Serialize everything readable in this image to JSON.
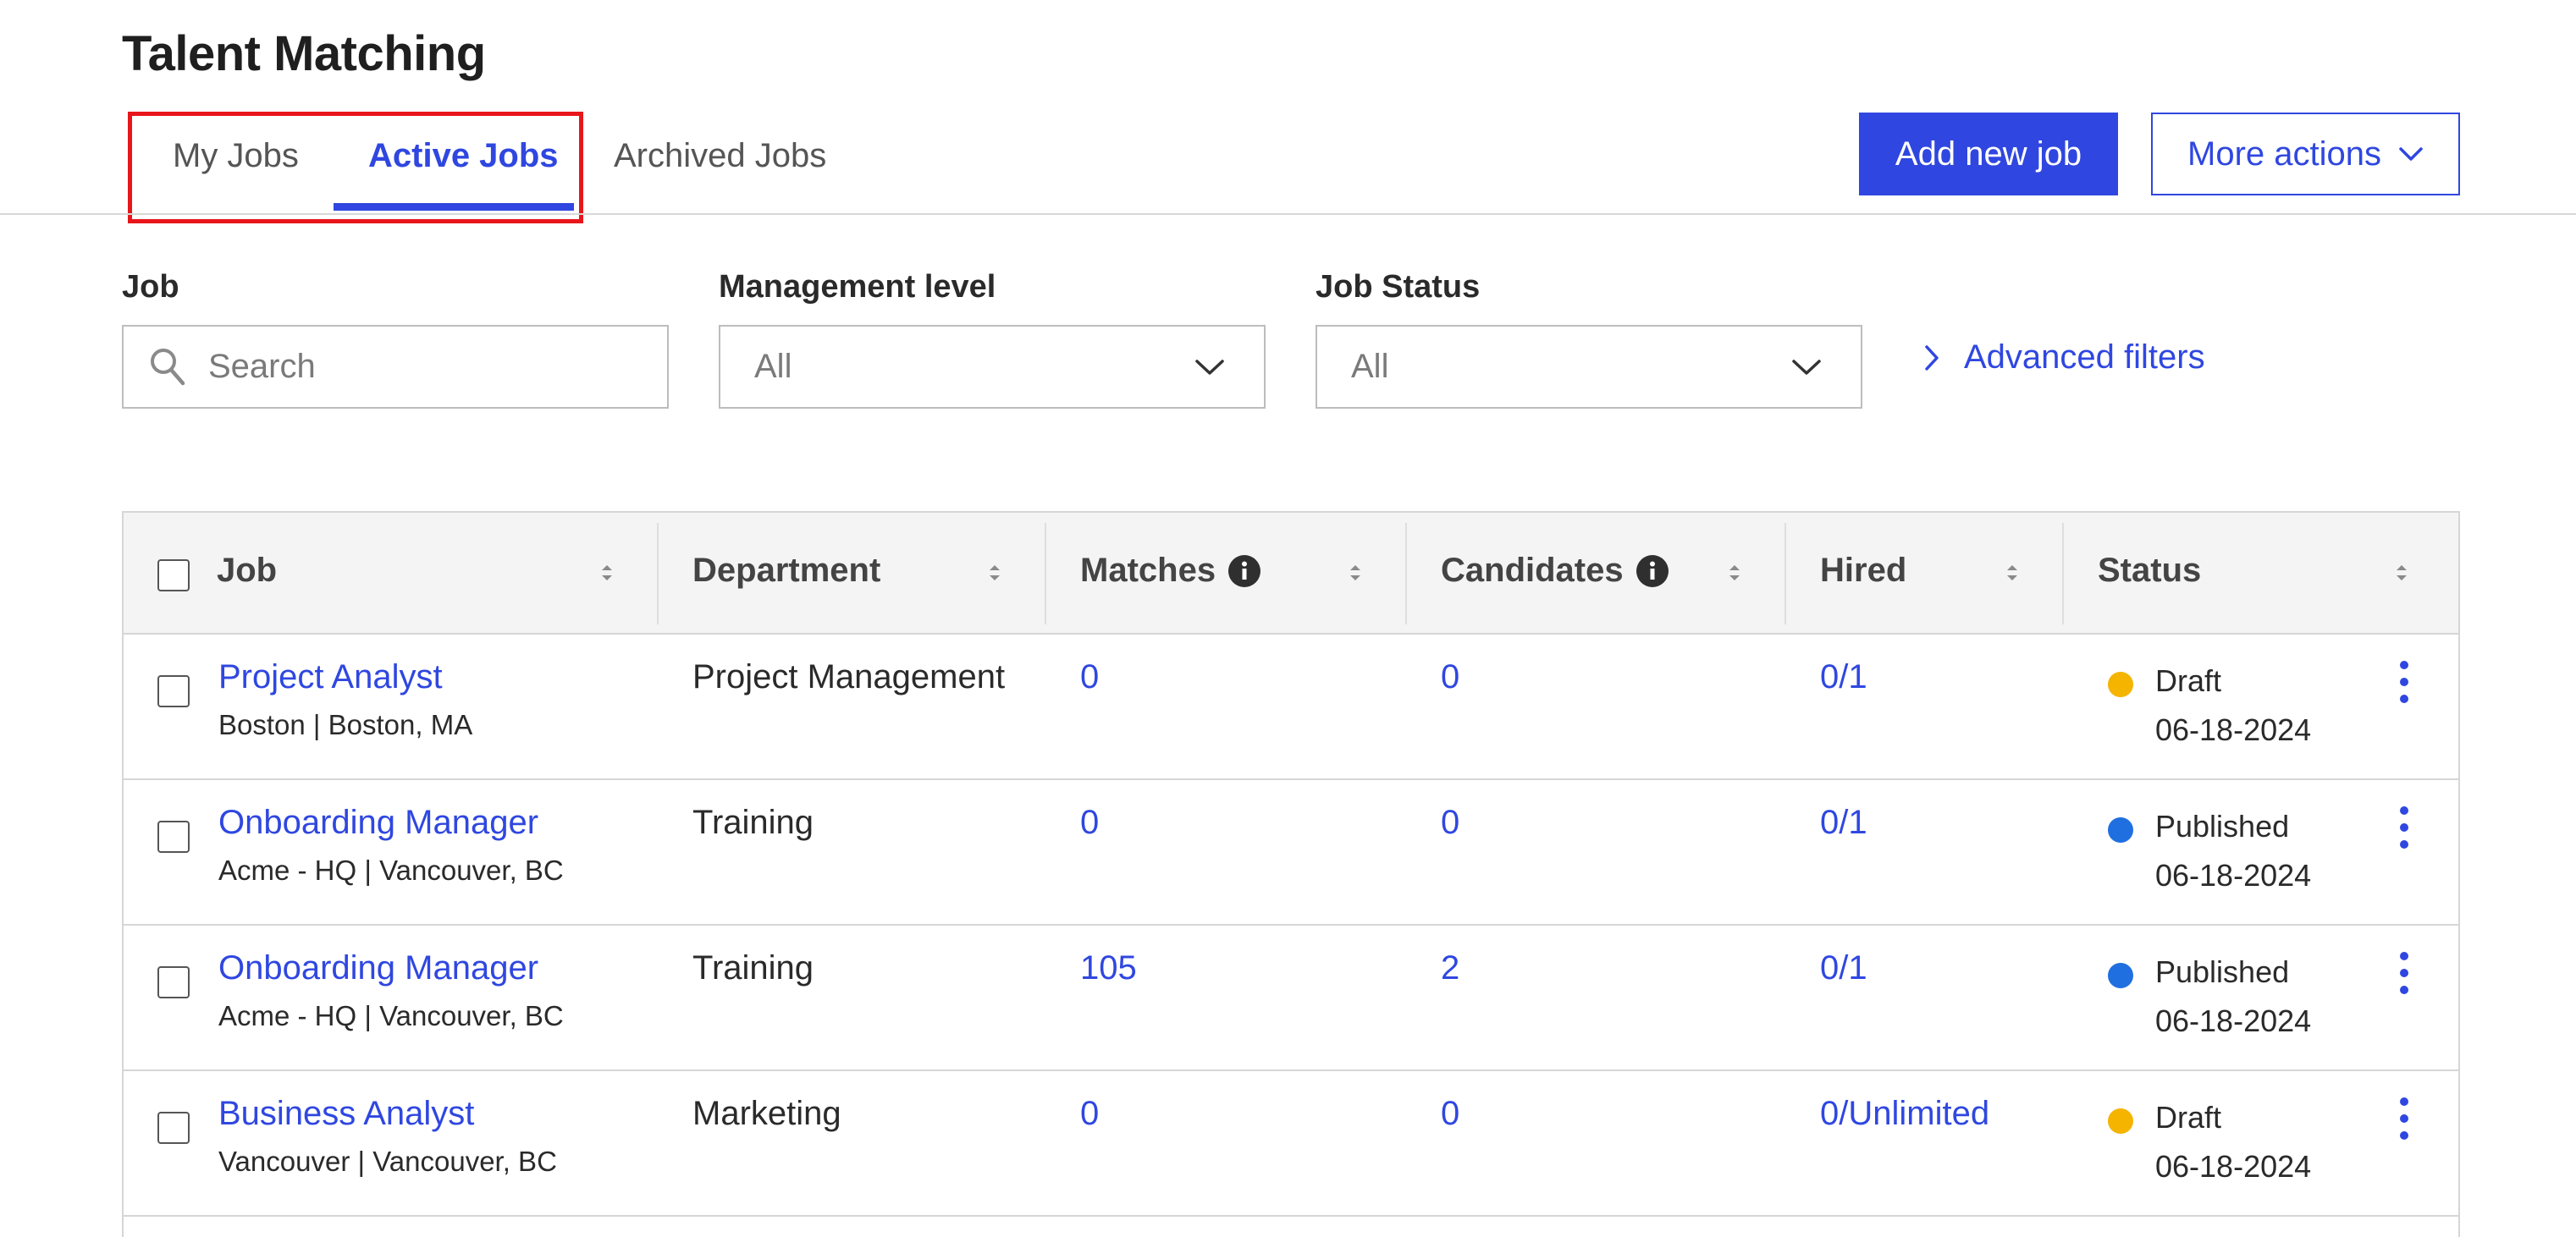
{
  "header": {
    "title": "Talent Matching",
    "tabs": [
      {
        "label": "My Jobs",
        "active": false
      },
      {
        "label": "Active Jobs",
        "active": true
      },
      {
        "label": "Archived Jobs",
        "active": false
      }
    ],
    "add_button": "Add new job",
    "more_actions": "More actions"
  },
  "filters": {
    "job_label": "Job",
    "job_placeholder": "Search",
    "management_label": "Management level",
    "management_value": "All",
    "status_label": "Job Status",
    "status_value": "All",
    "advanced": "Advanced filters"
  },
  "table": {
    "columns": [
      "Job",
      "Department",
      "Matches",
      "Candidates",
      "Hired",
      "Status"
    ],
    "rows": [
      {
        "title": "Project Analyst",
        "location": "Boston  |  Boston, MA",
        "department": "Project Management",
        "matches": "0",
        "candidates": "0",
        "hired": "0/1",
        "status": "Draft",
        "date": "06-18-2024"
      },
      {
        "title": "Onboarding Manager",
        "location": "Acme - HQ  |  Vancouver, BC",
        "department": "Training",
        "matches": "0",
        "candidates": "0",
        "hired": "0/1",
        "status": "Published",
        "date": "06-18-2024"
      },
      {
        "title": "Onboarding Manager",
        "location": "Acme - HQ  |  Vancouver, BC",
        "department": "Training",
        "matches": "105",
        "candidates": "2",
        "hired": "0/1",
        "status": "Published",
        "date": "06-18-2024"
      },
      {
        "title": "Business Analyst",
        "location": "Vancouver  |  Vancouver, BC",
        "department": "Marketing",
        "matches": "0",
        "candidates": "0",
        "hired": "0/Unlimited",
        "status": "Draft",
        "date": "06-18-2024"
      }
    ]
  },
  "colors": {
    "accent": "#2f47e0",
    "draft": "#f5b400",
    "published": "#1f6fe0",
    "highlight": "#e8161b"
  },
  "icons": {
    "search": "search-icon",
    "chevron_down": "chevron-down-icon",
    "chevron_right": "chevron-right-icon",
    "info": "info-icon",
    "sort": "sort-icon",
    "kebab": "kebab-menu-icon"
  }
}
